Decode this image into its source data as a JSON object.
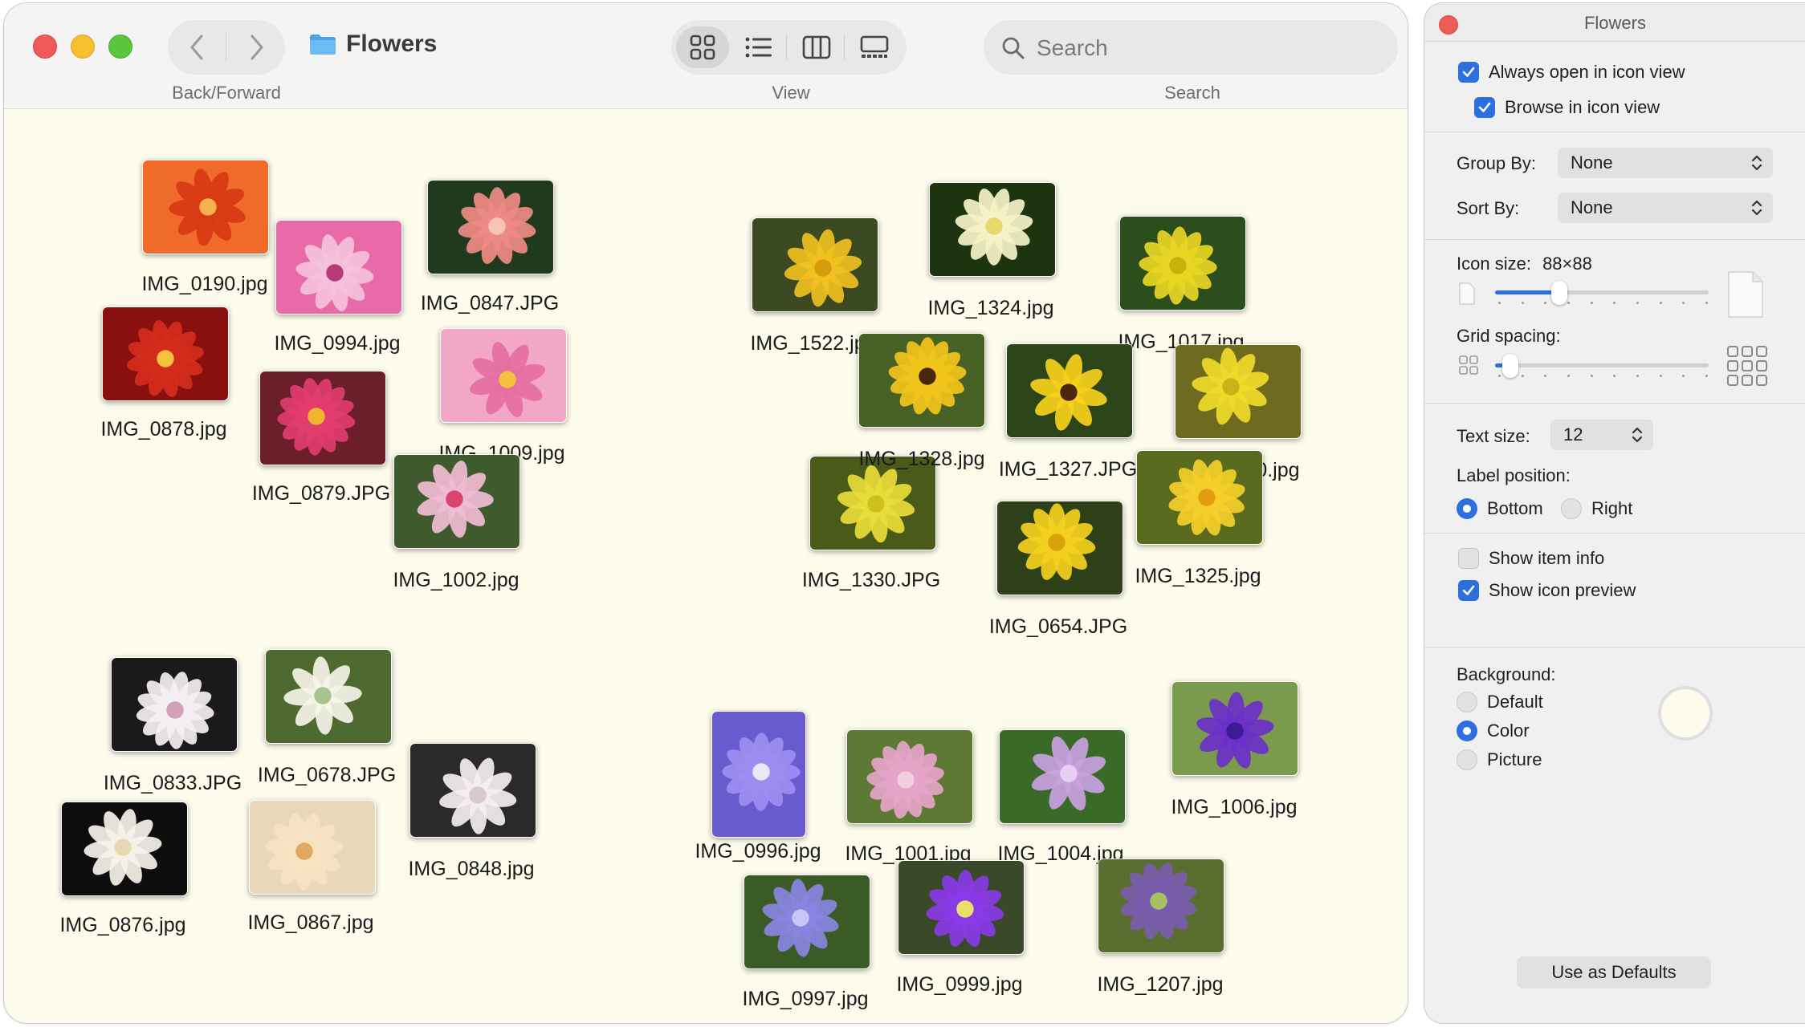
{
  "window": {
    "title": "Flowers",
    "toolbar": {
      "nav_label": "Back/Forward",
      "view_label": "View",
      "search_label": "Search",
      "search_placeholder": "Search",
      "views": [
        "icon-view",
        "list-view",
        "column-view",
        "gallery-view"
      ],
      "active_view": "icon-view"
    },
    "background_color": "#fdfbec"
  },
  "files": [
    {
      "name": "IMG_0190.jpg",
      "palette": [
        "#f06a2a",
        "#d83a14",
        "#f7b34b"
      ]
    },
    {
      "name": "IMG_0994.jpg",
      "palette": [
        "#e86aa8",
        "#f6c1dd",
        "#b43c7c"
      ]
    },
    {
      "name": "IMG_0847.JPG",
      "palette": [
        "#203a1e",
        "#f08a86",
        "#f7c5b6"
      ]
    },
    {
      "name": "IMG_0878.jpg",
      "palette": [
        "#8a1010",
        "#d42c1c",
        "#f6c23a"
      ]
    },
    {
      "name": "IMG_0879.JPG",
      "palette": [
        "#6b1f2a",
        "#e13d6e",
        "#f1b52d"
      ]
    },
    {
      "name": "IMG_1009.jpg",
      "palette": [
        "#f2a7c6",
        "#e66fa2",
        "#f5c13a"
      ]
    },
    {
      "name": "IMG_1002.jpg",
      "palette": [
        "#3f5a2c",
        "#f0bcd2",
        "#d9456e"
      ]
    },
    {
      "name": "IMG_1522.jpg",
      "palette": [
        "#3b4a20",
        "#f0c020",
        "#d79c0c"
      ]
    },
    {
      "name": "IMG_1324.jpg",
      "palette": [
        "#1d3410",
        "#f6f2c8",
        "#e8d96a"
      ]
    },
    {
      "name": "IMG_1017.jpg",
      "palette": [
        "#2c4e1c",
        "#e8d624",
        "#c6b20e"
      ]
    },
    {
      "name": "IMG_1328.jpg",
      "palette": [
        "#476224",
        "#f2c41c",
        "#4a260c"
      ]
    },
    {
      "name": "IMG_1327.JPG",
      "palette": [
        "#2b4418",
        "#f7d11c",
        "#4a260c"
      ]
    },
    {
      "name": "IMG_1020.jpg",
      "palette": [
        "#6e6a20",
        "#eedb2a",
        "#c9b418"
      ]
    },
    {
      "name": "IMG_1330.JPG",
      "palette": [
        "#4a5a18",
        "#e8dc3a",
        "#cfc020"
      ]
    },
    {
      "name": "IMG_0654.JPG",
      "palette": [
        "#2e4018",
        "#f3d01e",
        "#d9a30e"
      ]
    },
    {
      "name": "IMG_1325.jpg",
      "palette": [
        "#5a6a1e",
        "#f4cf2a",
        "#e49c12"
      ]
    },
    {
      "name": "IMG_0833.JPG",
      "palette": [
        "#1a1a1a",
        "#f5eef2",
        "#d2a0b8"
      ]
    },
    {
      "name": "IMG_0678.JPG",
      "palette": [
        "#4f6a30",
        "#f6f4ea",
        "#a7c28a"
      ]
    },
    {
      "name": "IMG_0848.jpg",
      "palette": [
        "#2a2a2a",
        "#f4eef0",
        "#d9c8d0"
      ]
    },
    {
      "name": "IMG_0876.jpg",
      "palette": [
        "#0d0d0d",
        "#f6f2ea",
        "#e7d8b4"
      ]
    },
    {
      "name": "IMG_0867.jpg",
      "palette": [
        "#e8d8b8",
        "#f6e2c2",
        "#e0a860"
      ]
    },
    {
      "name": "IMG_0996.jpg",
      "palette": [
        "#6a5ad0",
        "#9c8ef0",
        "#e8e8f6"
      ]
    },
    {
      "name": "IMG_1001.jpg",
      "palette": [
        "#5c7a34",
        "#e6a4c8",
        "#f0d0e0"
      ]
    },
    {
      "name": "IMG_1004.jpg",
      "palette": [
        "#3a6a28",
        "#c9a2e0",
        "#e6d0f0"
      ]
    },
    {
      "name": "IMG_1006.jpg",
      "palette": [
        "#7a9a4e",
        "#6a30c8",
        "#3e1a96"
      ]
    },
    {
      "name": "IMG_0997.jpg",
      "palette": [
        "#3a5a26",
        "#8a84e0",
        "#c8c4f4"
      ]
    },
    {
      "name": "IMG_0999.jpg",
      "palette": [
        "#3a4a28",
        "#8a3ae6",
        "#e8e06a"
      ]
    },
    {
      "name": "IMG_1207.jpg",
      "palette": [
        "#5a6e30",
        "#7a5cae",
        "#a6c064"
      ]
    }
  ],
  "panel": {
    "title": "Flowers",
    "always_open": {
      "label": "Always open in icon view",
      "checked": true
    },
    "browse_in": {
      "label": "Browse in icon view",
      "checked": true
    },
    "group_by": {
      "label": "Group By:",
      "value": "None"
    },
    "sort_by": {
      "label": "Sort By:",
      "value": "None"
    },
    "icon_size": {
      "label": "Icon size:",
      "value": "88×88",
      "fraction": 0.3
    },
    "grid_spacing": {
      "label": "Grid spacing:",
      "fraction": 0.07
    },
    "text_size": {
      "label": "Text size:",
      "value": "12"
    },
    "label_position": {
      "label": "Label position:",
      "options": [
        "Bottom",
        "Right"
      ],
      "selected": "Bottom"
    },
    "show_item_info": {
      "label": "Show item info",
      "checked": false
    },
    "show_icon_preview": {
      "label": "Show icon preview",
      "checked": true
    },
    "background": {
      "label": "Background:",
      "options": [
        "Default",
        "Color",
        "Picture"
      ],
      "selected": "Color"
    },
    "defaults_button": "Use as Defaults"
  }
}
